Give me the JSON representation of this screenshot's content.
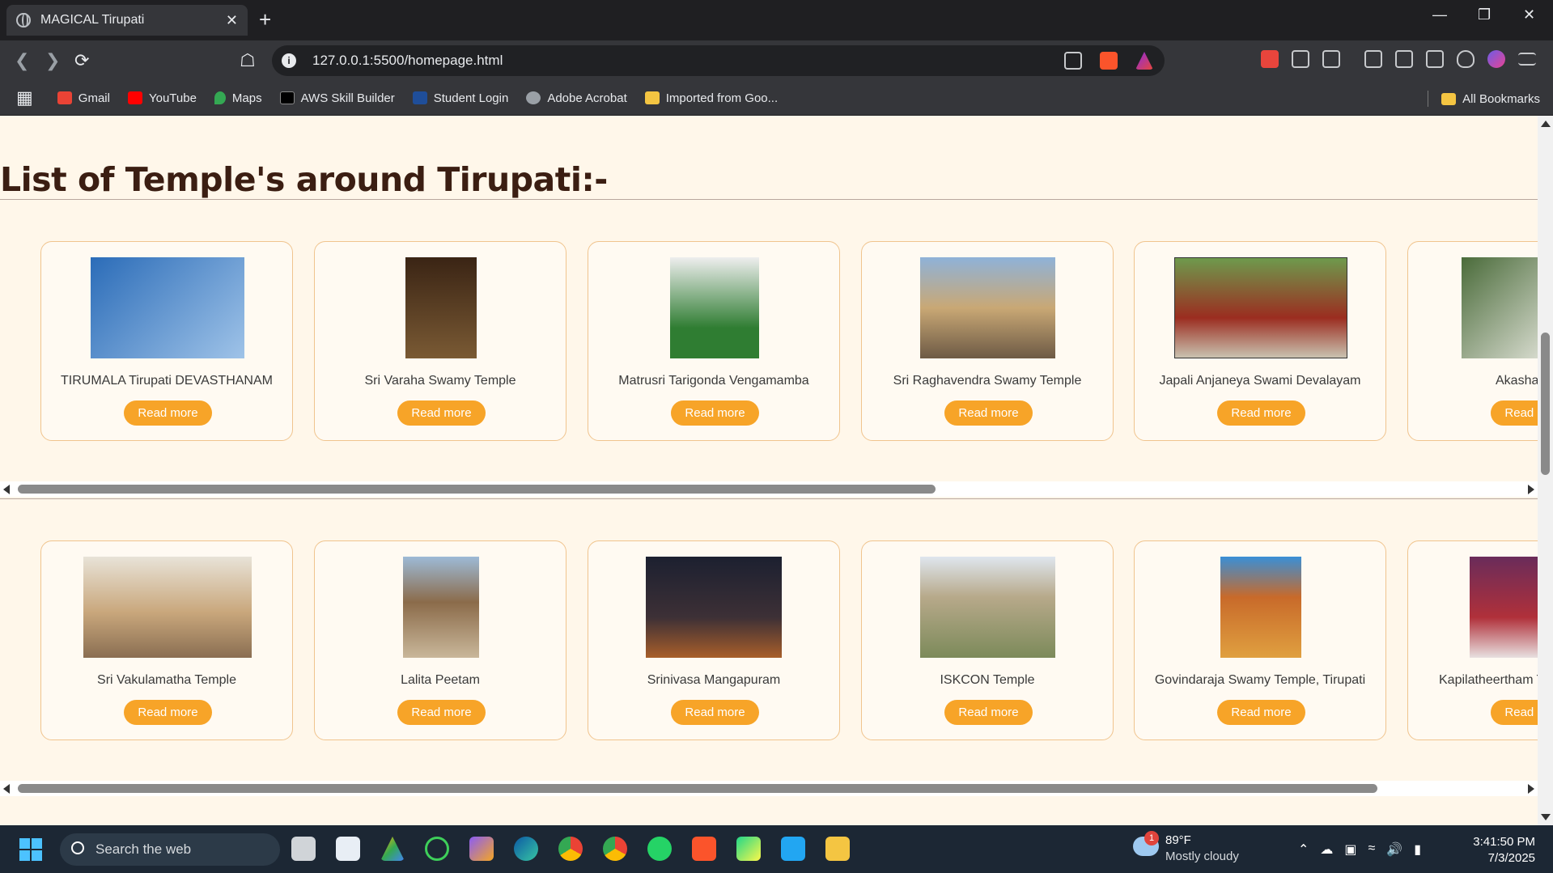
{
  "browser": {
    "tab_title": "MAGICAL Tirupati",
    "url": "127.0.0.1:5500/homepage.html",
    "bookmarks": [
      {
        "label": "Gmail",
        "color": "#ea4335"
      },
      {
        "label": "YouTube",
        "color": "#ff0000"
      },
      {
        "label": "Maps",
        "color": "#34a853"
      },
      {
        "label": "AWS Skill Builder",
        "color": "#232f3e"
      },
      {
        "label": "Student Login",
        "color": "#1f4e99"
      },
      {
        "label": "Adobe Acrobat",
        "color": "#cccccc"
      },
      {
        "label": "Imported from Goo...",
        "color": "#f4c542"
      }
    ],
    "all_bookmarks": "All Bookmarks"
  },
  "page": {
    "heading": "List of Temple's around Tirupati:-",
    "read_more": "Read more",
    "accent_color": "#f7a428",
    "rows": [
      {
        "temples": [
          {
            "name": "TIRUMALA Tirupati DEVASTHANAM",
            "img_color": "#4f86c6"
          },
          {
            "name": "Sri Varaha Swamy Temple",
            "img_color": "#5a3b20"
          },
          {
            "name": "Matrusri Tarigonda Vengamamba",
            "img_color": "#2f7d32"
          },
          {
            "name": "Sri Raghavendra Swamy Temple",
            "img_color": "#a9875c"
          },
          {
            "name": "Japali Anjaneya Swami Devalayam",
            "img_color": "#9b2d20"
          },
          {
            "name": "Akashag",
            "img_color": "#6d8f5a"
          }
        ]
      },
      {
        "temples": [
          {
            "name": "Sri Vakulamatha Temple",
            "img_color": "#c9a77c"
          },
          {
            "name": "Lalita Peetam",
            "img_color": "#8b6b4a"
          },
          {
            "name": "Srinivasa Mangapuram",
            "img_color": "#2e2a30"
          },
          {
            "name": "ISKCON Temple",
            "img_color": "#b7a98a"
          },
          {
            "name": "Govindaraja Swamy Temple, Tirupati",
            "img_color": "#c86a2a"
          },
          {
            "name": "Kapilatheertham T",
            "img_color": "#b0303a"
          }
        ]
      }
    ]
  },
  "taskbar": {
    "search_placeholder": "Search the web",
    "weather_badge": "1",
    "temperature": "89°F",
    "weather_desc": "Mostly cloudy",
    "time": "3:41:50 PM",
    "date": "7/3/2025"
  }
}
